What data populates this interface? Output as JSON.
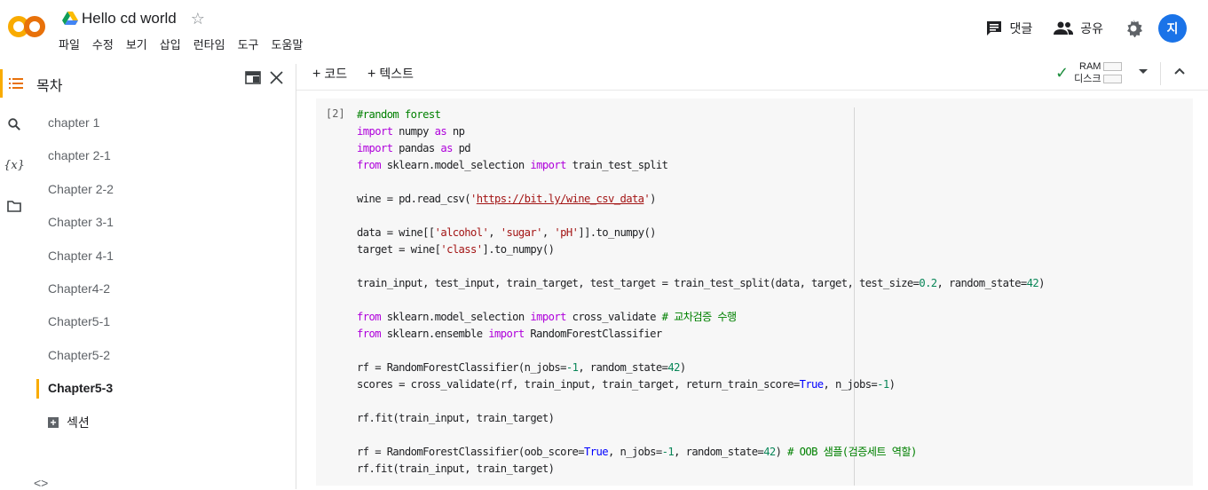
{
  "app": {
    "doc_title": "Hello cd world",
    "menu": [
      "파일",
      "수정",
      "보기",
      "삽입",
      "런타임",
      "도구",
      "도움말"
    ],
    "comment_label": "댓글",
    "share_label": "공유",
    "avatar_initial": "지"
  },
  "toolbar": {
    "add_code": "코드",
    "add_text": "텍스트",
    "ram_label": "RAM",
    "disk_label": "디스크"
  },
  "sidebar": {
    "title": "목차",
    "items": [
      {
        "label": "chapter 1"
      },
      {
        "label": "chapter 2-1"
      },
      {
        "label": "Chapter 2-2"
      },
      {
        "label": "Chapter 3-1"
      },
      {
        "label": "Chapter 4-1"
      },
      {
        "label": "Chapter4-2"
      },
      {
        "label": "Chapter5-1"
      },
      {
        "label": "Chapter5-2"
      },
      {
        "label": "Chapter5-3",
        "active": true
      }
    ],
    "add_section": "섹션",
    "code_toggle": "<>"
  },
  "cell": {
    "execution_count": "[2]",
    "lines": [
      [
        [
          "cm",
          "#random forest"
        ]
      ],
      [
        [
          "kw",
          "import"
        ],
        [
          "",
          " numpy "
        ],
        [
          "kw",
          "as"
        ],
        [
          "",
          " np"
        ]
      ],
      [
        [
          "kw",
          "import"
        ],
        [
          "",
          " pandas "
        ],
        [
          "kw",
          "as"
        ],
        [
          "",
          " pd"
        ]
      ],
      [
        [
          "kw",
          "from"
        ],
        [
          "",
          " sklearn.model_selection "
        ],
        [
          "kw",
          "import"
        ],
        [
          "",
          " train_test_split"
        ]
      ],
      [],
      [
        [
          "",
          "wine = pd.read_csv("
        ],
        [
          "st",
          "'"
        ],
        [
          "url",
          "https://bit.ly/wine_csv_data"
        ],
        [
          "st",
          "'"
        ],
        [
          "",
          ")"
        ]
      ],
      [],
      [
        [
          "",
          "data = wine[["
        ],
        [
          "st",
          "'alcohol'"
        ],
        [
          "",
          ", "
        ],
        [
          "st",
          "'sugar'"
        ],
        [
          "",
          ", "
        ],
        [
          "st",
          "'pH'"
        ],
        [
          "",
          "]].to_numpy()"
        ]
      ],
      [
        [
          "",
          "target = wine["
        ],
        [
          "st",
          "'class'"
        ],
        [
          "",
          "].to_numpy()"
        ]
      ],
      [],
      [
        [
          "",
          "train_input, test_input, train_target, test_target = train_test_split(data, target, test_size="
        ],
        [
          "num",
          "0.2"
        ],
        [
          "",
          ", random_state="
        ],
        [
          "num",
          "42"
        ],
        [
          "",
          ")"
        ]
      ],
      [],
      [
        [
          "kw",
          "from"
        ],
        [
          "",
          " sklearn.model_selection "
        ],
        [
          "kw",
          "import"
        ],
        [
          "",
          " cross_validate "
        ],
        [
          "cm",
          "# 교차검증 수행"
        ]
      ],
      [
        [
          "kw",
          "from"
        ],
        [
          "",
          " sklearn.ensemble "
        ],
        [
          "kw",
          "import"
        ],
        [
          "",
          " RandomForestClassifier"
        ]
      ],
      [],
      [
        [
          "",
          "rf = RandomForestClassifier(n_jobs="
        ],
        [
          "num",
          "-1"
        ],
        [
          "",
          ", random_state="
        ],
        [
          "num",
          "42"
        ],
        [
          "",
          ")"
        ]
      ],
      [
        [
          "",
          "scores = cross_validate(rf, train_input, train_target, return_train_score="
        ],
        [
          "tr",
          "True"
        ],
        [
          "",
          ", n_jobs="
        ],
        [
          "num",
          "-1"
        ],
        [
          "",
          ")"
        ]
      ],
      [],
      [
        [
          "",
          "rf.fit(train_input, train_target)"
        ]
      ],
      [],
      [
        [
          "",
          "rf = RandomForestClassifier(oob_score="
        ],
        [
          "tr",
          "True"
        ],
        [
          "",
          ", n_jobs="
        ],
        [
          "num",
          "-1"
        ],
        [
          "",
          ", random_state="
        ],
        [
          "num",
          "42"
        ],
        [
          "",
          ") "
        ],
        [
          "cm",
          "# OOB 샘플(검증세트 역할)"
        ]
      ],
      [
        [
          "",
          "rf.fit(train_input, train_target)"
        ]
      ]
    ]
  },
  "colors": {
    "accent": "#f9ab00",
    "avatar": "#1a73e8",
    "keyword": "#af00db",
    "comment": "#008000",
    "string": "#a31515",
    "number": "#098658",
    "ok": "#1e8e3e"
  },
  "icons": [
    "colab-logo",
    "drive-icon",
    "star-icon",
    "comment-icon",
    "people-icon",
    "gear-icon",
    "toc-icon",
    "search-icon",
    "variables-icon",
    "folder-icon",
    "open-in-tab-icon",
    "close-icon",
    "check-icon",
    "chevron-down-icon",
    "chevron-up-icon"
  ]
}
